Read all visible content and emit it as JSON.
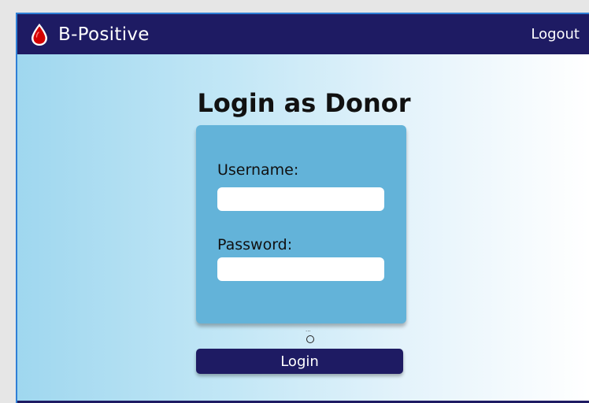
{
  "navbar": {
    "brand_name": "B-Positive",
    "logout_label": "Logout",
    "brand_icon": "blood-drop-icon"
  },
  "page": {
    "title": "Login as Donor"
  },
  "form": {
    "username_label": "Username:",
    "username_value": "",
    "password_label": "Password:",
    "password_value": "",
    "dots": "...",
    "login_label": "Login"
  },
  "colors": {
    "navbar": "#1e1b63",
    "card": "#63b3d9",
    "drop": "#d40000",
    "button": "#1e1b63"
  }
}
